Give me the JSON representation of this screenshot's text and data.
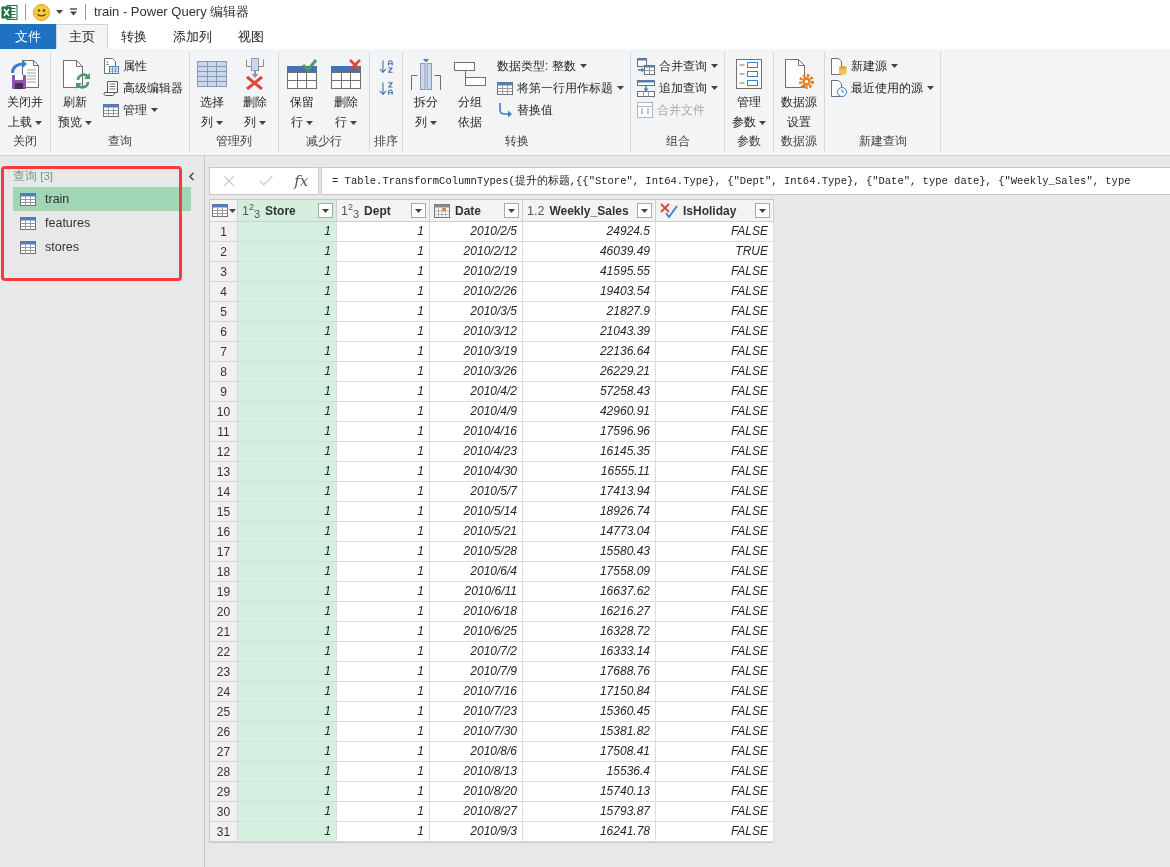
{
  "window": {
    "title": "train - Power Query 编辑器"
  },
  "tabs": [
    {
      "kind": "file",
      "label": "文件",
      "selected": false
    },
    {
      "kind": "tab",
      "label": "主页",
      "selected": true
    },
    {
      "kind": "tab",
      "label": "转换",
      "selected": false
    },
    {
      "kind": "tab",
      "label": "添加列",
      "selected": false
    },
    {
      "kind": "tab",
      "label": "视图",
      "selected": false
    }
  ],
  "ribbon": {
    "groups": [
      {
        "label": "关闭",
        "buttons": [
          {
            "kind": "large",
            "lines": [
              "关闭并",
              "上载"
            ],
            "dropdown": true,
            "disabled": false
          }
        ]
      },
      {
        "label": "查询",
        "buttons": [
          {
            "kind": "large",
            "lines": [
              "刷新",
              "预览"
            ],
            "dropdown": true,
            "disabled": false
          },
          {
            "kind": "small",
            "lines": [
              "属性"
            ],
            "dropdown": false,
            "disabled": false
          },
          {
            "kind": "small",
            "lines": [
              "高级编辑器"
            ],
            "dropdown": false,
            "disabled": false
          },
          {
            "kind": "small",
            "lines": [
              "管理"
            ],
            "dropdown": true,
            "disabled": false
          }
        ]
      },
      {
        "label": "管理列",
        "buttons": [
          {
            "kind": "large",
            "lines": [
              "选择",
              "列"
            ],
            "dropdown": true,
            "disabled": false
          },
          {
            "kind": "large",
            "lines": [
              "删除",
              "列"
            ],
            "dropdown": true,
            "disabled": false
          }
        ]
      },
      {
        "label": "减少行",
        "buttons": [
          {
            "kind": "large",
            "lines": [
              "保留",
              "行"
            ],
            "dropdown": true,
            "disabled": false
          },
          {
            "kind": "large",
            "lines": [
              "删除",
              "行"
            ],
            "dropdown": true,
            "disabled": false
          }
        ]
      },
      {
        "label": "排序",
        "buttons": [
          {
            "kind": "icon",
            "disabled": false
          },
          {
            "kind": "icon",
            "disabled": false
          }
        ]
      },
      {
        "label": "转换",
        "buttons": [
          {
            "kind": "large",
            "lines": [
              "拆分",
              "列"
            ],
            "dropdown": true,
            "disabled": false
          },
          {
            "kind": "large",
            "lines": [
              "分组",
              "依据"
            ],
            "dropdown": false,
            "disabled": false
          },
          {
            "kind": "small",
            "lines": [
              "数据类型: 整数"
            ],
            "dropdown": true,
            "disabled": false
          },
          {
            "kind": "small",
            "lines": [
              "将第一行用作标题"
            ],
            "dropdown": true,
            "disabled": false
          },
          {
            "kind": "small",
            "lines": [
              "替换值"
            ],
            "dropdown": false,
            "disabled": false
          }
        ]
      },
      {
        "label": "组合",
        "buttons": [
          {
            "kind": "small",
            "lines": [
              "合并查询"
            ],
            "dropdown": true,
            "disabled": false
          },
          {
            "kind": "small",
            "lines": [
              "追加查询"
            ],
            "dropdown": true,
            "disabled": false
          },
          {
            "kind": "small",
            "lines": [
              "合并文件"
            ],
            "dropdown": false,
            "disabled": true
          }
        ]
      },
      {
        "label": "参数",
        "buttons": [
          {
            "kind": "large",
            "lines": [
              "管理",
              "参数"
            ],
            "dropdown": true,
            "disabled": false
          }
        ]
      },
      {
        "label": "数据源",
        "buttons": [
          {
            "kind": "large",
            "lines": [
              "数据源",
              "设置"
            ],
            "dropdown": false,
            "disabled": false
          }
        ]
      },
      {
        "label": "新建查询",
        "buttons": [
          {
            "kind": "small",
            "lines": [
              "新建源"
            ],
            "dropdown": true,
            "disabled": false
          },
          {
            "kind": "small",
            "lines": [
              "最近使用的源"
            ],
            "dropdown": true,
            "disabled": false
          }
        ]
      }
    ]
  },
  "sidebar": {
    "title": "查询 [3]",
    "highlighted": true,
    "queries": [
      {
        "name": "train",
        "selected": true
      },
      {
        "name": "features",
        "selected": false
      },
      {
        "name": "stores",
        "selected": false
      }
    ]
  },
  "formula_bar": {
    "function_label": "fx",
    "formula": "= Table.TransformColumnTypes(提升的标题,{{\"Store\", Int64.Type}, {\"Dept\", Int64.Type}, {\"Date\", type date}, {\"Weekly_Sales\", type"
  },
  "table": {
    "columns": [
      {
        "kind": "integer",
        "type_mark": "1$^{2}$$_{3}$",
        "name": "Store",
        "selected": true
      },
      {
        "kind": "integer",
        "type_mark": "1$^{2}$$_{3}$",
        "name": "Dept",
        "selected": false
      },
      {
        "kind": "date",
        "name": "Date",
        "selected": false
      },
      {
        "kind": "decimal",
        "type_mark": "1.2",
        "name": "Weekly_Sales",
        "selected": false
      },
      {
        "kind": "logical",
        "name": "IsHoliday",
        "selected": false
      }
    ],
    "rows": [
      {
        "number": "1",
        "cells": [
          "1",
          "1",
          "2010/2/5",
          "24924.5",
          "FALSE"
        ]
      },
      {
        "number": "2",
        "cells": [
          "1",
          "1",
          "2010/2/12",
          "46039.49",
          "TRUE"
        ]
      },
      {
        "number": "3",
        "cells": [
          "1",
          "1",
          "2010/2/19",
          "41595.55",
          "FALSE"
        ]
      },
      {
        "number": "4",
        "cells": [
          "1",
          "1",
          "2010/2/26",
          "19403.54",
          "FALSE"
        ]
      },
      {
        "number": "5",
        "cells": [
          "1",
          "1",
          "2010/3/5",
          "21827.9",
          "FALSE"
        ]
      },
      {
        "number": "6",
        "cells": [
          "1",
          "1",
          "2010/3/12",
          "21043.39",
          "FALSE"
        ]
      },
      {
        "number": "7",
        "cells": [
          "1",
          "1",
          "2010/3/19",
          "22136.64",
          "FALSE"
        ]
      },
      {
        "number": "8",
        "cells": [
          "1",
          "1",
          "2010/3/26",
          "26229.21",
          "FALSE"
        ]
      },
      {
        "number": "9",
        "cells": [
          "1",
          "1",
          "2010/4/2",
          "57258.43",
          "FALSE"
        ]
      },
      {
        "number": "10",
        "cells": [
          "1",
          "1",
          "2010/4/9",
          "42960.91",
          "FALSE"
        ]
      },
      {
        "number": "11",
        "cells": [
          "1",
          "1",
          "2010/4/16",
          "17596.96",
          "FALSE"
        ]
      },
      {
        "number": "12",
        "cells": [
          "1",
          "1",
          "2010/4/23",
          "16145.35",
          "FALSE"
        ]
      },
      {
        "number": "13",
        "cells": [
          "1",
          "1",
          "2010/4/30",
          "16555.11",
          "FALSE"
        ]
      },
      {
        "number": "14",
        "cells": [
          "1",
          "1",
          "2010/5/7",
          "17413.94",
          "FALSE"
        ]
      },
      {
        "number": "15",
        "cells": [
          "1",
          "1",
          "2010/5/14",
          "18926.74",
          "FALSE"
        ]
      },
      {
        "number": "16",
        "cells": [
          "1",
          "1",
          "2010/5/21",
          "14773.04",
          "FALSE"
        ]
      },
      {
        "number": "17",
        "cells": [
          "1",
          "1",
          "2010/5/28",
          "15580.43",
          "FALSE"
        ]
      },
      {
        "number": "18",
        "cells": [
          "1",
          "1",
          "2010/6/4",
          "17558.09",
          "FALSE"
        ]
      },
      {
        "number": "19",
        "cells": [
          "1",
          "1",
          "2010/6/11",
          "16637.62",
          "FALSE"
        ]
      },
      {
        "number": "20",
        "cells": [
          "1",
          "1",
          "2010/6/18",
          "16216.27",
          "FALSE"
        ]
      },
      {
        "number": "21",
        "cells": [
          "1",
          "1",
          "2010/6/25",
          "16328.72",
          "FALSE"
        ]
      },
      {
        "number": "22",
        "cells": [
          "1",
          "1",
          "2010/7/2",
          "16333.14",
          "FALSE"
        ]
      },
      {
        "number": "23",
        "cells": [
          "1",
          "1",
          "2010/7/9",
          "17688.76",
          "FALSE"
        ]
      },
      {
        "number": "24",
        "cells": [
          "1",
          "1",
          "2010/7/16",
          "17150.84",
          "FALSE"
        ]
      },
      {
        "number": "25",
        "cells": [
          "1",
          "1",
          "2010/7/23",
          "15360.45",
          "FALSE"
        ]
      },
      {
        "number": "26",
        "cells": [
          "1",
          "1",
          "2010/7/30",
          "15381.82",
          "FALSE"
        ]
      },
      {
        "number": "27",
        "cells": [
          "1",
          "1",
          "2010/8/6",
          "17508.41",
          "FALSE"
        ]
      },
      {
        "number": "28",
        "cells": [
          "1",
          "1",
          "2010/8/13",
          "15536.4",
          "FALSE"
        ]
      },
      {
        "number": "29",
        "cells": [
          "1",
          "1",
          "2010/8/20",
          "15740.13",
          "FALSE"
        ]
      },
      {
        "number": "30",
        "cells": [
          "1",
          "1",
          "2010/8/27",
          "15793.87",
          "FALSE"
        ]
      },
      {
        "number": "31",
        "cells": [
          "1",
          "1",
          "2010/9/3",
          "16241.78",
          "FALSE"
        ]
      }
    ]
  }
}
